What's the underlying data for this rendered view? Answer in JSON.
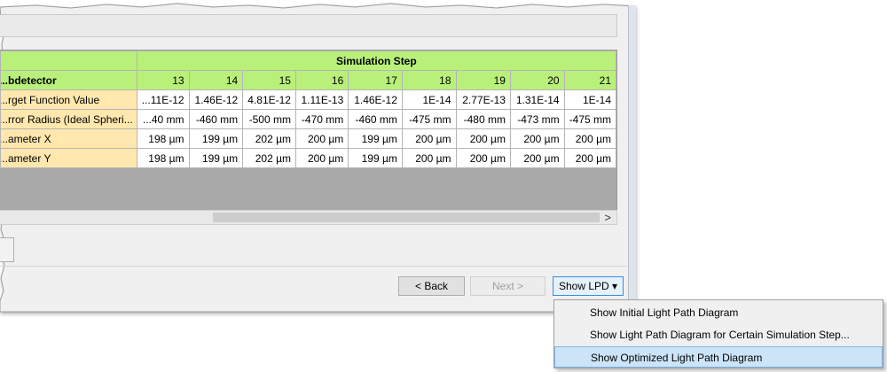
{
  "table": {
    "group_header": "Simulation Step",
    "first_col_header": "...bdetector",
    "steps": [
      "13",
      "14",
      "15",
      "16",
      "17",
      "18",
      "19",
      "20",
      "21"
    ],
    "rows": [
      {
        "label": "...rget Function Value",
        "values": [
          "...11E-12",
          "1.46E-12",
          "4.81E-12",
          "1.11E-13",
          "1.46E-12",
          "1E-14",
          "2.77E-13",
          "1.31E-14",
          "1E-14"
        ]
      },
      {
        "label": "...rror Radius (Ideal Spheri...",
        "values": [
          "...40 mm",
          "-460 mm",
          "-500 mm",
          "-470 mm",
          "-460 mm",
          "-475 mm",
          "-480 mm",
          "-473 mm",
          "-475 mm"
        ]
      },
      {
        "label": "...ameter X",
        "values": [
          "198 µm",
          "199 µm",
          "202 µm",
          "200 µm",
          "199 µm",
          "200 µm",
          "200 µm",
          "200 µm",
          "200 µm"
        ]
      },
      {
        "label": "...ameter Y",
        "values": [
          "198 µm",
          "199 µm",
          "202 µm",
          "200 µm",
          "199 µm",
          "200 µm",
          "200 µm",
          "200 µm",
          "200 µm"
        ]
      }
    ]
  },
  "scrollbar": {
    "right_arrow": ">"
  },
  "buttons": {
    "back": "< Back",
    "next": "Next >",
    "show_lpd": "Show  LPD ▾"
  },
  "menu": {
    "items": [
      "Show Initial Light Path Diagram",
      "Show Light Path Diagram for Certain Simulation Step...",
      "Show Optimized Light Path Diagram"
    ]
  }
}
